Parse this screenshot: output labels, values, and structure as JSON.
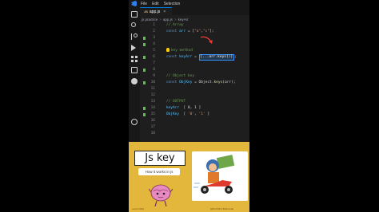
{
  "menu": [
    "File",
    "Edit",
    "Selection"
  ],
  "tab": {
    "badge": "JS",
    "label": "app.js",
    "close": "×"
  },
  "breadcrumb": [
    "js practice",
    "app.js",
    "keyArr"
  ],
  "breadcrumb_separator": ">",
  "lines": [
    {
      "num": "1",
      "changed": false,
      "tokens": [
        {
          "t": "    // Array",
          "c": "comment"
        }
      ]
    },
    {
      "num": "2",
      "changed": false,
      "tokens": [
        {
          "t": "    const ",
          "c": "kw"
        },
        {
          "t": "arr",
          "c": "var"
        },
        {
          "t": " = [",
          "c": "text"
        },
        {
          "t": "\"a\"",
          "c": "str"
        },
        {
          "t": ",",
          "c": "text"
        },
        {
          "t": "\"c\"",
          "c": "str"
        },
        {
          "t": "];",
          "c": "text"
        }
      ]
    },
    {
      "num": "3",
      "changed": true,
      "tokens": []
    },
    {
      "num": "4",
      "changed": true,
      "tokens": []
    },
    {
      "num": "5",
      "changed": false,
      "bulb": true,
      "tokens": [
        {
          "t": "key method",
          "c": "comment"
        }
      ]
    },
    {
      "num": "6",
      "changed": true,
      "tokens": [
        {
          "t": "    const ",
          "c": "kw"
        },
        {
          "t": "keyArr",
          "c": "var"
        },
        {
          "t": " = ",
          "c": "text"
        },
        {
          "t": "[...arr.keys()]",
          "c": "highlight"
        },
        {
          "t": ";",
          "c": "text"
        }
      ]
    },
    {
      "num": "7",
      "changed": false,
      "tokens": []
    },
    {
      "num": "8",
      "changed": true,
      "tokens": []
    },
    {
      "num": "9",
      "changed": false,
      "tokens": [
        {
          "t": "    // Object key",
          "c": "comment"
        }
      ]
    },
    {
      "num": "10",
      "changed": true,
      "tokens": [
        {
          "t": "    const ",
          "c": "kw"
        },
        {
          "t": "ObjKey",
          "c": "var"
        },
        {
          "t": " = Object.",
          "c": "text"
        },
        {
          "t": "keys",
          "c": "fn"
        },
        {
          "t": "(arr);",
          "c": "text"
        }
      ]
    },
    {
      "num": "11",
      "changed": false,
      "tokens": []
    },
    {
      "num": "12",
      "changed": false,
      "tokens": []
    },
    {
      "num": "13",
      "changed": false,
      "tokens": [
        {
          "t": "    // OUTPUT",
          "c": "comment"
        }
      ]
    },
    {
      "num": "14",
      "changed": true,
      "tokens": [
        {
          "t": "    keyArr  ",
          "c": "var"
        },
        {
          "t": "[ 0, 1 ]",
          "c": "text"
        }
      ]
    },
    {
      "num": "15",
      "changed": true,
      "tokens": [
        {
          "t": "    ObjKey  ",
          "c": "var"
        },
        {
          "t": "[ ",
          "c": "text"
        },
        {
          "t": "'0'",
          "c": "str"
        },
        {
          "t": ", ",
          "c": "text"
        },
        {
          "t": "'1'",
          "c": "str"
        },
        {
          "t": " ]",
          "c": "text"
        }
      ]
    },
    {
      "num": "16",
      "changed": false,
      "tokens": []
    },
    {
      "num": "17",
      "changed": false,
      "tokens": []
    },
    {
      "num": "18",
      "changed": false,
      "tokens": []
    }
  ],
  "banner": {
    "title": "Js key",
    "subtitle": "How it works in js",
    "brain_text": "@DevMindBraincode",
    "footer_left": "Learn Daily",
    "footer_right": "@DevMind Braincode"
  },
  "colors": {
    "comment": "#6a9955",
    "kw": "#569cd6",
    "var": "#4fc1ff",
    "str": "#ce9178",
    "fn": "#dcdcaa",
    "text": "#d4d4d4",
    "accent": "#0078d4",
    "banner": "#e3b63c"
  },
  "icons": [
    "vscode-logo-icon",
    "files-icon",
    "search-icon",
    "source-control-icon",
    "run-debug-icon",
    "extensions-icon",
    "remote-icon",
    "chat-icon",
    "account-icon",
    "lightbulb-icon",
    "arrow-icon"
  ]
}
